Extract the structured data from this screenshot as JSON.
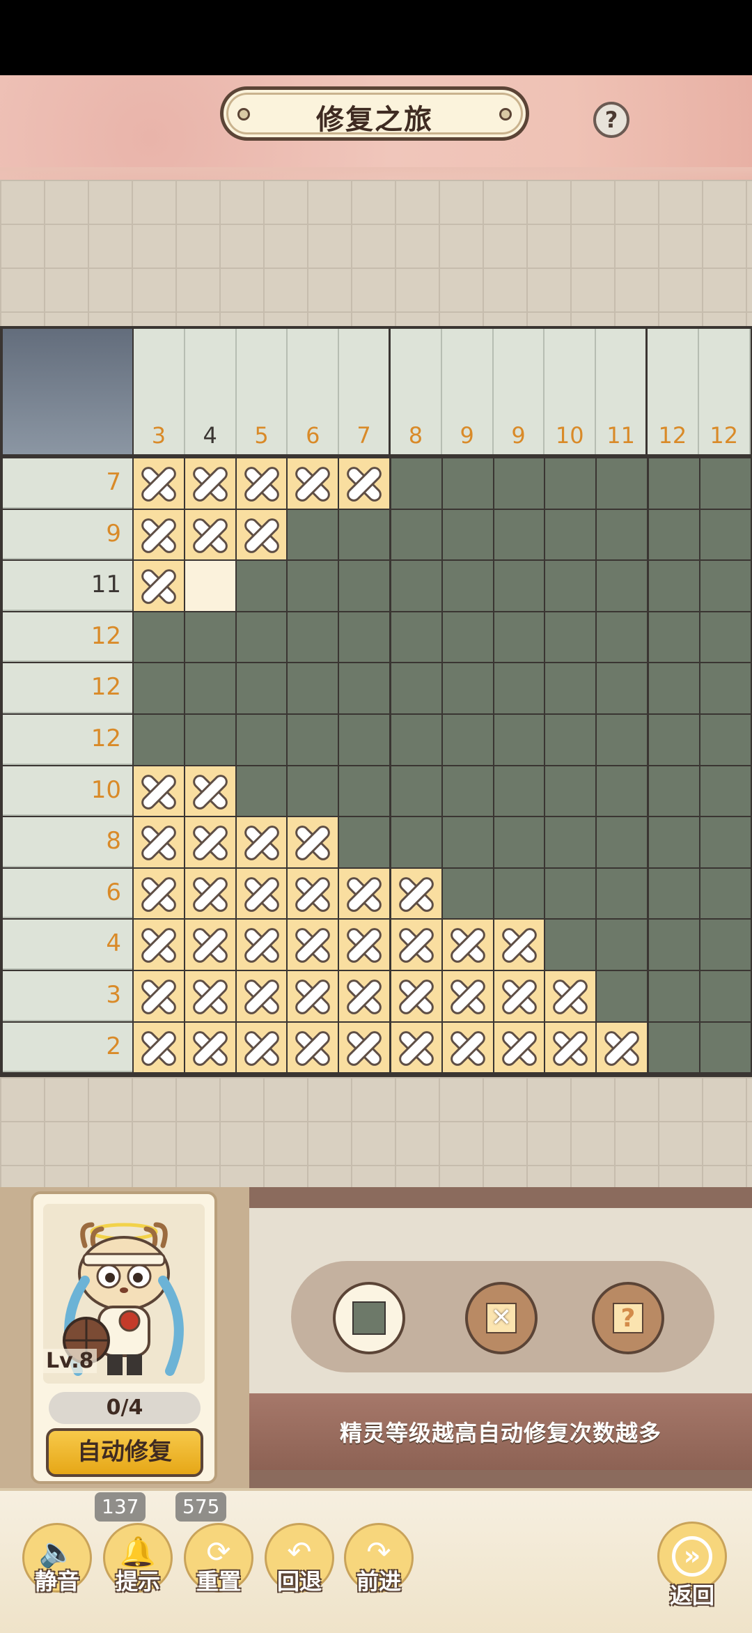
{
  "header": {
    "title": "修复之旅",
    "help_icon": "?"
  },
  "puzzle": {
    "column_clues": [
      "3",
      "4",
      "5",
      "6",
      "7",
      "8",
      "9",
      "9",
      "10",
      "11",
      "12",
      "12"
    ],
    "row_clues": [
      "7",
      "9",
      "11",
      "12",
      "12",
      "12",
      "10",
      "8",
      "6",
      "4",
      "3",
      "2"
    ],
    "highlighted_column": 1,
    "highlighted_row": 2,
    "rows": [
      "xxxxxfffffff",
      "xxxfffffffff",
      "xeffffffffff",
      "ffffffffffff",
      "ffffffffffff",
      "ffffffffffff",
      "xxffffffffff",
      "xxxxffffffff",
      "xxxxxxffffff",
      "xxxxxxxxffff",
      "xxxxxxxxxfff",
      "xxxxxxxxxxff"
    ],
    "legend": {
      "f": "filled",
      "x": "crossed",
      "e": "empty"
    },
    "colors": {
      "filled": "#6d7969",
      "crossed": "#f9dea0",
      "empty": "#fbf2dc",
      "clue_text": "#d98a28"
    }
  },
  "character": {
    "level": "Lv.8",
    "progress": "0/4",
    "auto_repair_label": "自动修复"
  },
  "tools": {
    "fill": "fill-tool",
    "cross": "cross-tool",
    "question": "?"
  },
  "tip": "精灵等级越高自动修复次数越多",
  "bottom_bar": {
    "mute_label": "静音",
    "hint_label": "提示",
    "hint_count": "137",
    "reset_label": "重置",
    "reset_count": "575",
    "undo_label": "回退",
    "redo_label": "前进",
    "back_label": "返回"
  }
}
